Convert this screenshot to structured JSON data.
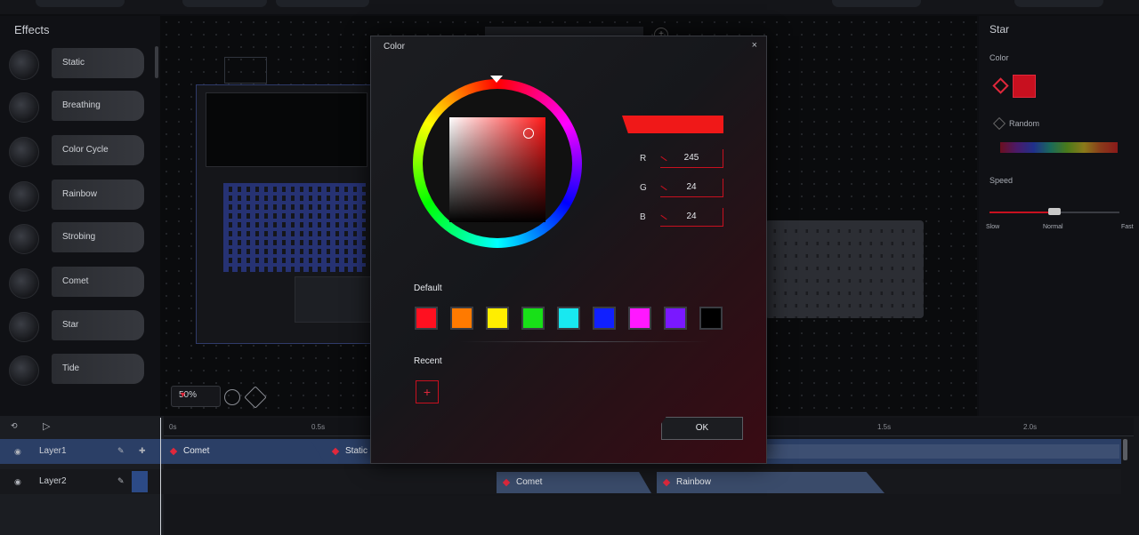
{
  "effects_panel": {
    "title": "Effects",
    "items": [
      {
        "label": "Static",
        "icon": "static-icon"
      },
      {
        "label": "Breathing",
        "icon": "breathing-icon"
      },
      {
        "label": "Color Cycle",
        "icon": "color-cycle-icon"
      },
      {
        "label": "Rainbow",
        "icon": "rainbow-icon"
      },
      {
        "label": "Strobing",
        "icon": "strobing-icon"
      },
      {
        "label": "Comet",
        "icon": "comet-icon"
      },
      {
        "label": "Star",
        "icon": "star-icon"
      },
      {
        "label": "Tide",
        "icon": "tide-icon"
      }
    ]
  },
  "canvas": {
    "zoom": "50%"
  },
  "right_panel": {
    "title": "Star",
    "color_label": "Color",
    "random_label": "Random",
    "speed_label": "Speed",
    "speed_slow": "Slow",
    "speed_normal": "Normal",
    "speed_fast": "Fast",
    "speed_level": 0.5,
    "selected_color": "#c8101f"
  },
  "dialog": {
    "title": "Color",
    "close": "×",
    "r_label": "R",
    "g_label": "G",
    "b_label": "B",
    "r_value": "245",
    "g_value": "24",
    "b_value": "24",
    "preview_color": "#f01818",
    "default_label": "Default",
    "default_colors": [
      "#ff1020",
      "#ff7a00",
      "#ffee00",
      "#18e018",
      "#18e8f0",
      "#1020ff",
      "#ff18ff",
      "#7a18ff",
      "#000000"
    ],
    "recent_label": "Recent",
    "add_symbol": "+",
    "ok_label": "OK"
  },
  "timeline": {
    "ruler": [
      "0s",
      "0.5s",
      "1.5s",
      "2.0s"
    ],
    "layers": [
      {
        "name": "Layer1",
        "clips": [
          "Comet",
          "Static"
        ]
      },
      {
        "name": "Layer2",
        "clips": [
          "Comet",
          "Rainbow"
        ]
      }
    ]
  },
  "accent": "#e0283c"
}
